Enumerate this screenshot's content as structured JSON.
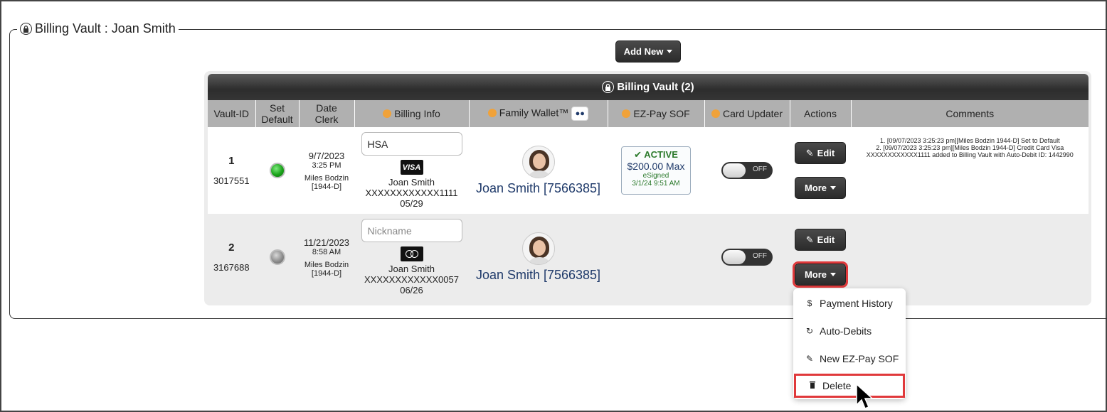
{
  "legend": {
    "title": "Billing Vault : Joan Smith"
  },
  "toolbar": {
    "add_new_label": "Add New"
  },
  "panel": {
    "title": "Billing Vault (2)"
  },
  "columns": {
    "vault_id": "Vault-ID",
    "set_default_1": "Set",
    "set_default_2": "Default",
    "date_1": "Date",
    "date_2": "Clerk",
    "billing_info": "Billing Info",
    "family_wallet": "Family Wallet™",
    "ezpay": "EZ-Pay SOF",
    "card_updater": "Card Updater",
    "actions": "Actions",
    "comments": "Comments"
  },
  "rows": [
    {
      "index": "1",
      "vault_id": "3017551",
      "is_default": true,
      "date": "9/7/2023",
      "time": "3:25 PM",
      "clerk_name": "Miles Bodzin",
      "clerk_code": "[1944-D]",
      "nickname_value": "HSA",
      "nickname_placeholder": "Nickname",
      "card_brand": "VISA",
      "card_holder": "Joan Smith",
      "card_number": "XXXXXXXXXXXX1111",
      "card_exp": "05/29",
      "wallet_name": "Joan Smith [7566385]",
      "sof": {
        "status": "ACTIVE",
        "amount": "$200.00 Max",
        "signed": "eSigned",
        "date": "3/1/24 9:51 AM"
      },
      "updater": "OFF",
      "edit_label": "Edit",
      "more_label": "More",
      "comments": [
        "1. [09/07/2023 3:25:23 pm][Miles Bodzin 1944-D] Set to Default",
        "2. [09/07/2023 3:25:23 pm][Miles Bodzin 1944-D] Credit Card Visa XXXXXXXXXXXX1111 added to Billing Vault with Auto-Debit ID: 1442990"
      ]
    },
    {
      "index": "2",
      "vault_id": "3167688",
      "is_default": false,
      "date": "11/21/2023",
      "time": "8:58 AM",
      "clerk_name": "Miles Bodzin",
      "clerk_code": "[1944-D]",
      "nickname_value": "",
      "nickname_placeholder": "Nickname",
      "card_brand": "mastercard",
      "card_holder": "Joan Smith",
      "card_number": "XXXXXXXXXXXX0057",
      "card_exp": "06/26",
      "wallet_name": "Joan Smith [7566385]",
      "updater": "OFF",
      "edit_label": "Edit",
      "more_label": "More"
    }
  ],
  "more_menu": {
    "payment_history": "Payment History",
    "auto_debits": "Auto-Debits",
    "new_ezpay": "New EZ-Pay SOF",
    "delete": "Delete"
  },
  "colors": {
    "highlight": "#e0393b",
    "dark_button": "#2b2b2b",
    "active_green": "#2c7a2c",
    "link_blue": "#1f3a6a"
  }
}
